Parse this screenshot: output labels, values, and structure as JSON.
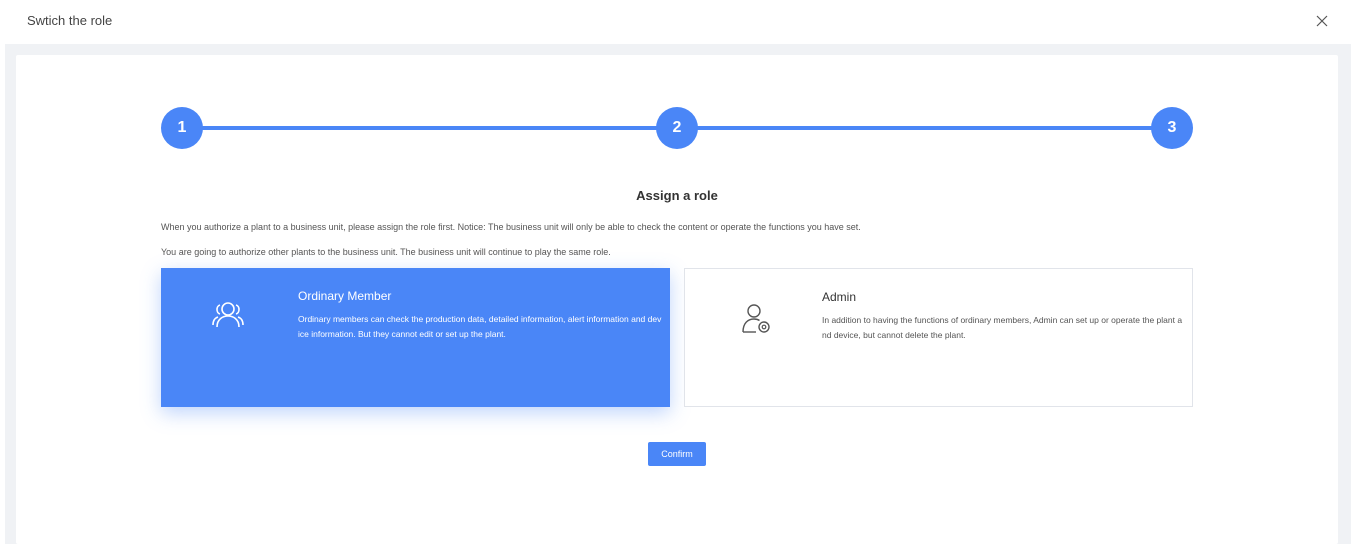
{
  "dialog": {
    "title": "Swtich the role",
    "close_icon": "close-icon"
  },
  "stepper": {
    "steps": [
      {
        "label": "1"
      },
      {
        "label": "2"
      },
      {
        "label": "3"
      }
    ],
    "current": 3,
    "accent_color": "#4a86f7"
  },
  "section": {
    "title": "Assign a role",
    "description_1": "When you authorize a plant to a business unit, please assign the role first. Notice: The business unit will only be able to check the content or operate the functions you have set.",
    "description_2": "You are going to authorize other plants to the business unit. The business unit will continue to play the same role."
  },
  "roles": [
    {
      "name": "Ordinary Member",
      "icon": "users-icon",
      "description": "Ordinary members can check the production data, detailed information, alert information and device information. But they cannot edit or set up the plant.",
      "selected": true
    },
    {
      "name": "Admin",
      "icon": "user-gear-icon",
      "description": "In addition to having the functions of ordinary members, Admin can set up or operate the plant and device, but cannot delete the plant.",
      "selected": false
    }
  ],
  "actions": {
    "confirm_label": "Confirm"
  }
}
